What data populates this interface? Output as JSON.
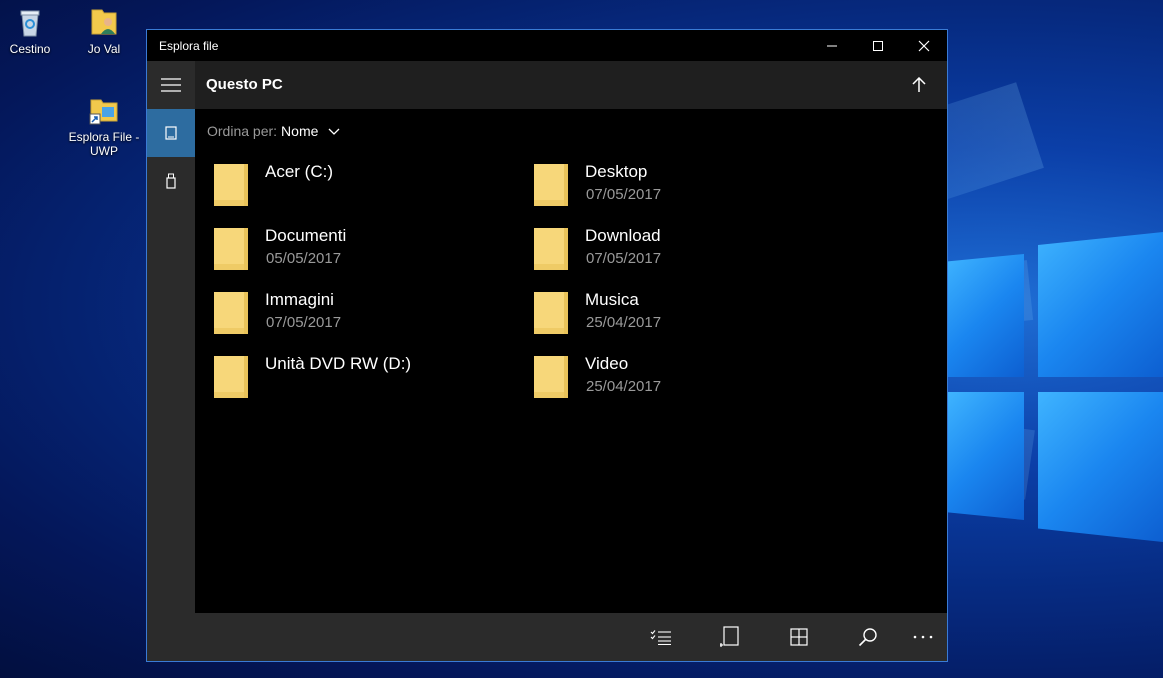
{
  "desktop": {
    "icons": [
      {
        "label": "Cestino",
        "icon": "recycle-bin-icon"
      },
      {
        "label": "Jo Val",
        "icon": "user-folder-icon"
      },
      {
        "label": "Esplora File - UWP",
        "icon": "folder-shortcut-icon"
      }
    ]
  },
  "window": {
    "title": "Esplora file",
    "controls": {
      "minimize": "minimize-icon",
      "maximize": "maximize-icon",
      "close": "close-icon"
    }
  },
  "sidebar": {
    "items": [
      {
        "icon": "hamburger-menu-icon"
      },
      {
        "icon": "device-icon",
        "active": true
      },
      {
        "icon": "usb-drive-icon"
      }
    ]
  },
  "header": {
    "title": "Questo PC",
    "up_icon": "arrow-up-icon"
  },
  "sort": {
    "label": "Ordina per:",
    "value": "Nome"
  },
  "items": [
    {
      "name": "Acer (C:)",
      "date": ""
    },
    {
      "name": "Desktop",
      "date": "07/05/2017"
    },
    {
      "name": "Documenti",
      "date": "05/05/2017"
    },
    {
      "name": "Download",
      "date": "07/05/2017"
    },
    {
      "name": "Immagini",
      "date": "07/05/2017"
    },
    {
      "name": "Musica",
      "date": "25/04/2017"
    },
    {
      "name": "Unità DVD RW (D:)",
      "date": ""
    },
    {
      "name": "Video",
      "date": "25/04/2017"
    }
  ],
  "bottombar": {
    "buttons": [
      "select-list-icon",
      "new-item-icon",
      "grid-view-icon",
      "search-icon",
      "more-icon"
    ]
  },
  "colors": {
    "accent": "#2d6ca0",
    "folder": "#f7d77a"
  }
}
